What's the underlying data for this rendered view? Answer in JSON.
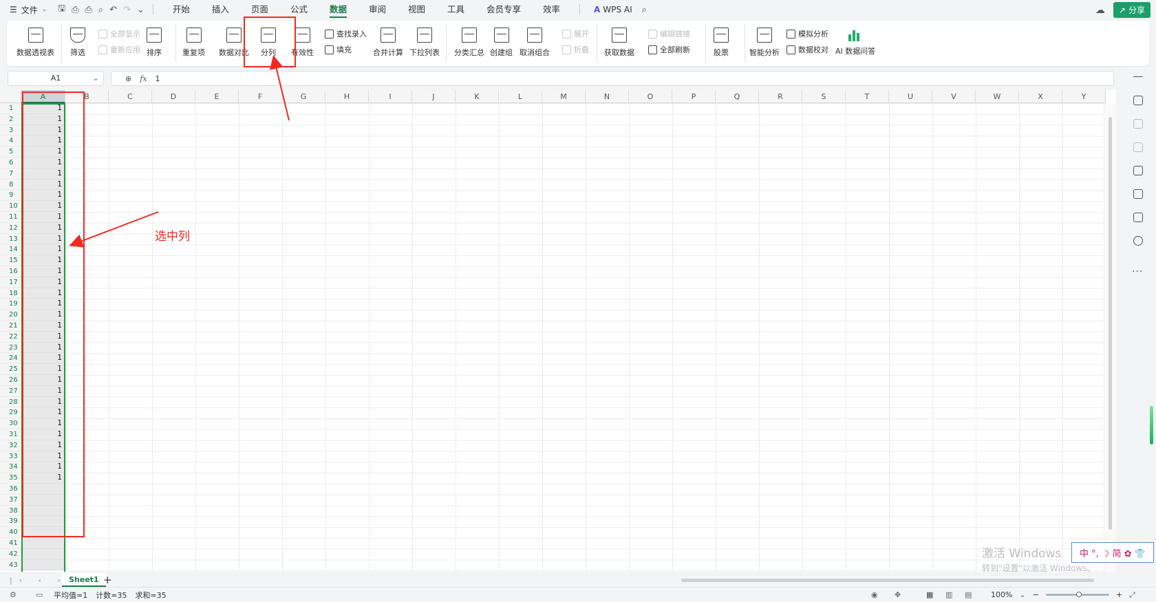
{
  "menubar": {
    "file_label": "文件",
    "tabs": [
      "开始",
      "插入",
      "页面",
      "公式",
      "数据",
      "审阅",
      "视图",
      "工具",
      "会员专享",
      "效率"
    ],
    "active_tab": "数据",
    "wps_ai_label": "WPS AI",
    "share_label": "分享"
  },
  "ribbon": {
    "pivot": "数据透视表",
    "filter": "筛选",
    "show_all": "全部显示",
    "reapply": "重新应用",
    "sort": "排序",
    "duplicates": "重复项",
    "compare": "数据对比",
    "split": "分列",
    "validation": "有效性",
    "find_entry": "查找录入",
    "fill": "填充",
    "consolidate": "合并计算",
    "dropdown_list": "下拉列表",
    "subtotal": "分类汇总",
    "create_group": "创建组",
    "ungroup": "取消组合",
    "expand": "展开",
    "collapse": "折叠",
    "get_data": "获取数据",
    "edit_links": "编辑链接",
    "refresh_all": "全部刷新",
    "stocks": "股票",
    "smart_analysis": "智能分析",
    "what_if": "模拟分析",
    "data_check": "数据校对",
    "ai_qa": "AI 数据问答"
  },
  "formula_bar": {
    "name_box": "A1",
    "fx_label": "fx",
    "value": "1"
  },
  "grid": {
    "columns": [
      "A",
      "B",
      "C",
      "D",
      "E",
      "F",
      "G",
      "H",
      "I",
      "J",
      "K",
      "L",
      "M",
      "N",
      "O",
      "P",
      "Q",
      "R",
      "S",
      "T",
      "U",
      "V",
      "W",
      "X",
      "Y"
    ],
    "row_numbers": [
      "1",
      "2",
      "3",
      "4",
      "5",
      "6",
      "7",
      "8",
      "9",
      "10",
      "11",
      "12",
      "13",
      "14",
      "15",
      "16",
      "17",
      "18",
      "19",
      "20",
      "21",
      "22",
      "23",
      "24",
      "25",
      "26",
      "27",
      "28",
      "29",
      "30",
      "31",
      "32",
      "33",
      "34",
      "35",
      "36",
      "37",
      "38",
      "39",
      "40",
      "41",
      "42",
      "43"
    ],
    "column_a_values": [
      "1",
      "1",
      "1",
      "1",
      "1",
      "1",
      "1",
      "1",
      "1",
      "1",
      "1",
      "1",
      "1",
      "1",
      "1",
      "1",
      "1",
      "1",
      "1",
      "1",
      "1",
      "1",
      "1",
      "1",
      "1",
      "1",
      "1",
      "1",
      "1",
      "1",
      "1",
      "1",
      "1",
      "1",
      "1",
      "",
      "",
      "",
      "",
      "",
      "",
      "",
      ""
    ],
    "selected_column": "A"
  },
  "sheets": {
    "tabs": [
      "Sheet1"
    ],
    "add_label": "+"
  },
  "statusbar": {
    "average": "平均值=1",
    "count": "计数=35",
    "sum": "求和=35",
    "zoom": "100%"
  },
  "watermark": {
    "line1": "激活 Windows",
    "line2": "转到\"设置\"以激活 Windows。"
  },
  "ime": {
    "text": "中 °, ☽ 简 ✿ 👕"
  },
  "annotation": {
    "label": "选中列",
    "color": "#f02a20"
  }
}
